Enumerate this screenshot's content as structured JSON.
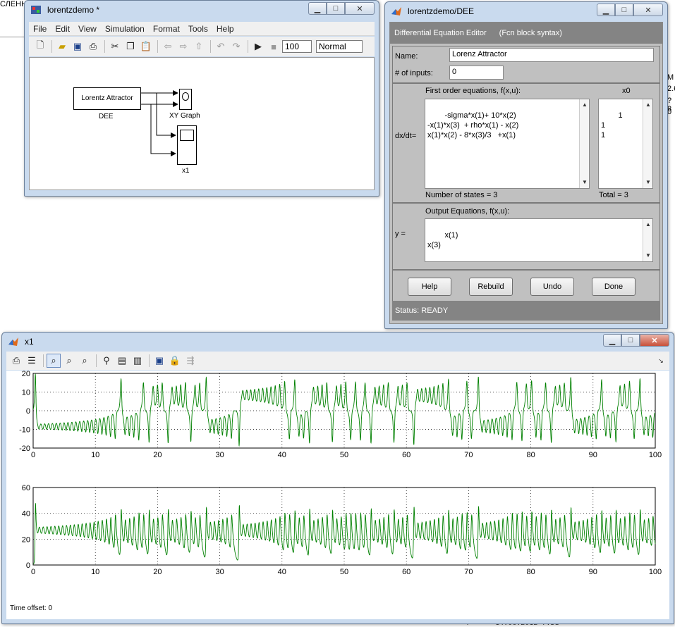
{
  "background": {
    "left_text": "СЛЕНН",
    "right_chars": [
      "М",
      "2.6",
      "?8",
      "0"
    ],
    "bottom_text": "!==*== 14.06.2012 7:31 ==*"
  },
  "sim_window": {
    "title": "lorentzdemo *",
    "menu": [
      "File",
      "Edit",
      "View",
      "Simulation",
      "Format",
      "Tools",
      "Help"
    ],
    "stop_time": "100",
    "sim_mode": "Normal",
    "blocks": {
      "dee_label": "Lorentz Attractor",
      "dee_name": "DEE",
      "xy_name": "XY Graph",
      "scope_name": "x1"
    }
  },
  "dee_window": {
    "title": "lorentzdemo/DEE",
    "header_title": "Differential Equation Editor",
    "header_subtitle": "(Fcn block syntax)",
    "name_label": "Name:",
    "name_value": "Lorenz Attractor",
    "inputs_label": "# of inputs:",
    "inputs_value": "0",
    "eq_header": "First order equations, f(x,u):",
    "x0_header": "x0",
    "dxdt_label": "dx/dt=",
    "equations": "-sigma*x(1)+ 10*x(2)\n-x(1)*x(3)  + rho*x(1) - x(2)\nx(1)*x(2) - 8*x(3)/3   +x(1)",
    "x0_values": "1\n1\n1",
    "num_states": "Number of states = 3",
    "total": "Total = 3",
    "out_header": "Output Equations, f(x,u):",
    "y_label": "y =",
    "outputs": "x(1)\nx(3)",
    "buttons": {
      "help": "Help",
      "rebuild": "Rebuild",
      "undo": "Undo",
      "done": "Done"
    },
    "status": "Status:  READY"
  },
  "scope_window": {
    "title": "x1",
    "time_offset": "Time offset:   0"
  },
  "colors": {
    "trace": "#008000",
    "grid": "#000000"
  },
  "chart_data": [
    {
      "type": "line",
      "x_ticks": [
        0,
        10,
        20,
        30,
        40,
        50,
        60,
        70,
        80,
        90,
        100
      ],
      "y_ticks": [
        -20,
        -10,
        0,
        10,
        20
      ],
      "xlim": [
        0,
        100
      ],
      "ylim": [
        -20,
        20
      ],
      "grid": true,
      "series": [
        {
          "values_approx": "x(1): settles near -8 with growing oscillation to t≈22, then chaotic switching between -17 and 17"
        }
      ]
    },
    {
      "type": "line",
      "x_ticks": [
        0,
        10,
        20,
        30,
        40,
        50,
        60,
        70,
        80,
        90,
        100
      ],
      "y_ticks": [
        0,
        20,
        40,
        60
      ],
      "xlim": [
        0,
        100
      ],
      "ylim": [
        0,
        60
      ],
      "grid": true,
      "series": [
        {
          "values_approx": "x(3): oscillates around 27 with growing amplitude, chaotic between 5 and 48 after t≈22"
        }
      ]
    }
  ]
}
